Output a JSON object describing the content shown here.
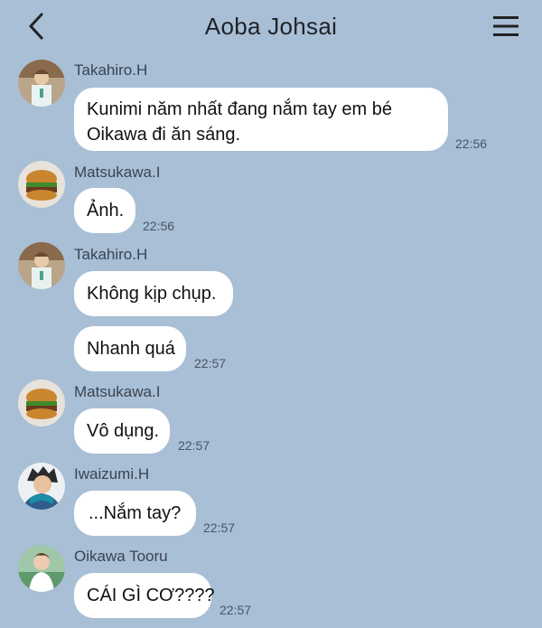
{
  "header": {
    "title": "Aoba Johsai",
    "back_icon": "chevron-left-icon",
    "menu_icon": "hamburger-menu-icon"
  },
  "messages": [
    {
      "sender": "Takahiro.H",
      "avatar": "takahiro-avatar",
      "lines": [
        "Kunimi năm nhất đang nắm tay em bé",
        "Oikawa đi ăn sáng."
      ],
      "time": "22:56"
    },
    {
      "sender": "Matsukawa.I",
      "avatar": "matsukawa-avatar",
      "lines": [
        "Ảnh."
      ],
      "time": "22:56"
    },
    {
      "sender": "Takahiro.H",
      "avatar": "takahiro-avatar",
      "lines": [
        "Không kịp chụp."
      ],
      "time": ""
    },
    {
      "sender": "",
      "avatar": "",
      "lines": [
        "Nhanh quá"
      ],
      "time": "22:57"
    },
    {
      "sender": "Matsukawa.I",
      "avatar": "matsukawa-avatar",
      "lines": [
        "Vô dụng."
      ],
      "time": "22:57"
    },
    {
      "sender": "Iwaizumi.H",
      "avatar": "iwaizumi-avatar",
      "lines": [
        "...Nắm tay?"
      ],
      "time": "22:57"
    },
    {
      "sender": "Oikawa Tooru",
      "avatar": "oikawa-avatar",
      "lines": [
        "CÁI GÌ CƠ????"
      ],
      "time": "22:57"
    }
  ],
  "colors": {
    "background": "#a8bfd6",
    "bubble": "#ffffff",
    "text": "#111111"
  }
}
